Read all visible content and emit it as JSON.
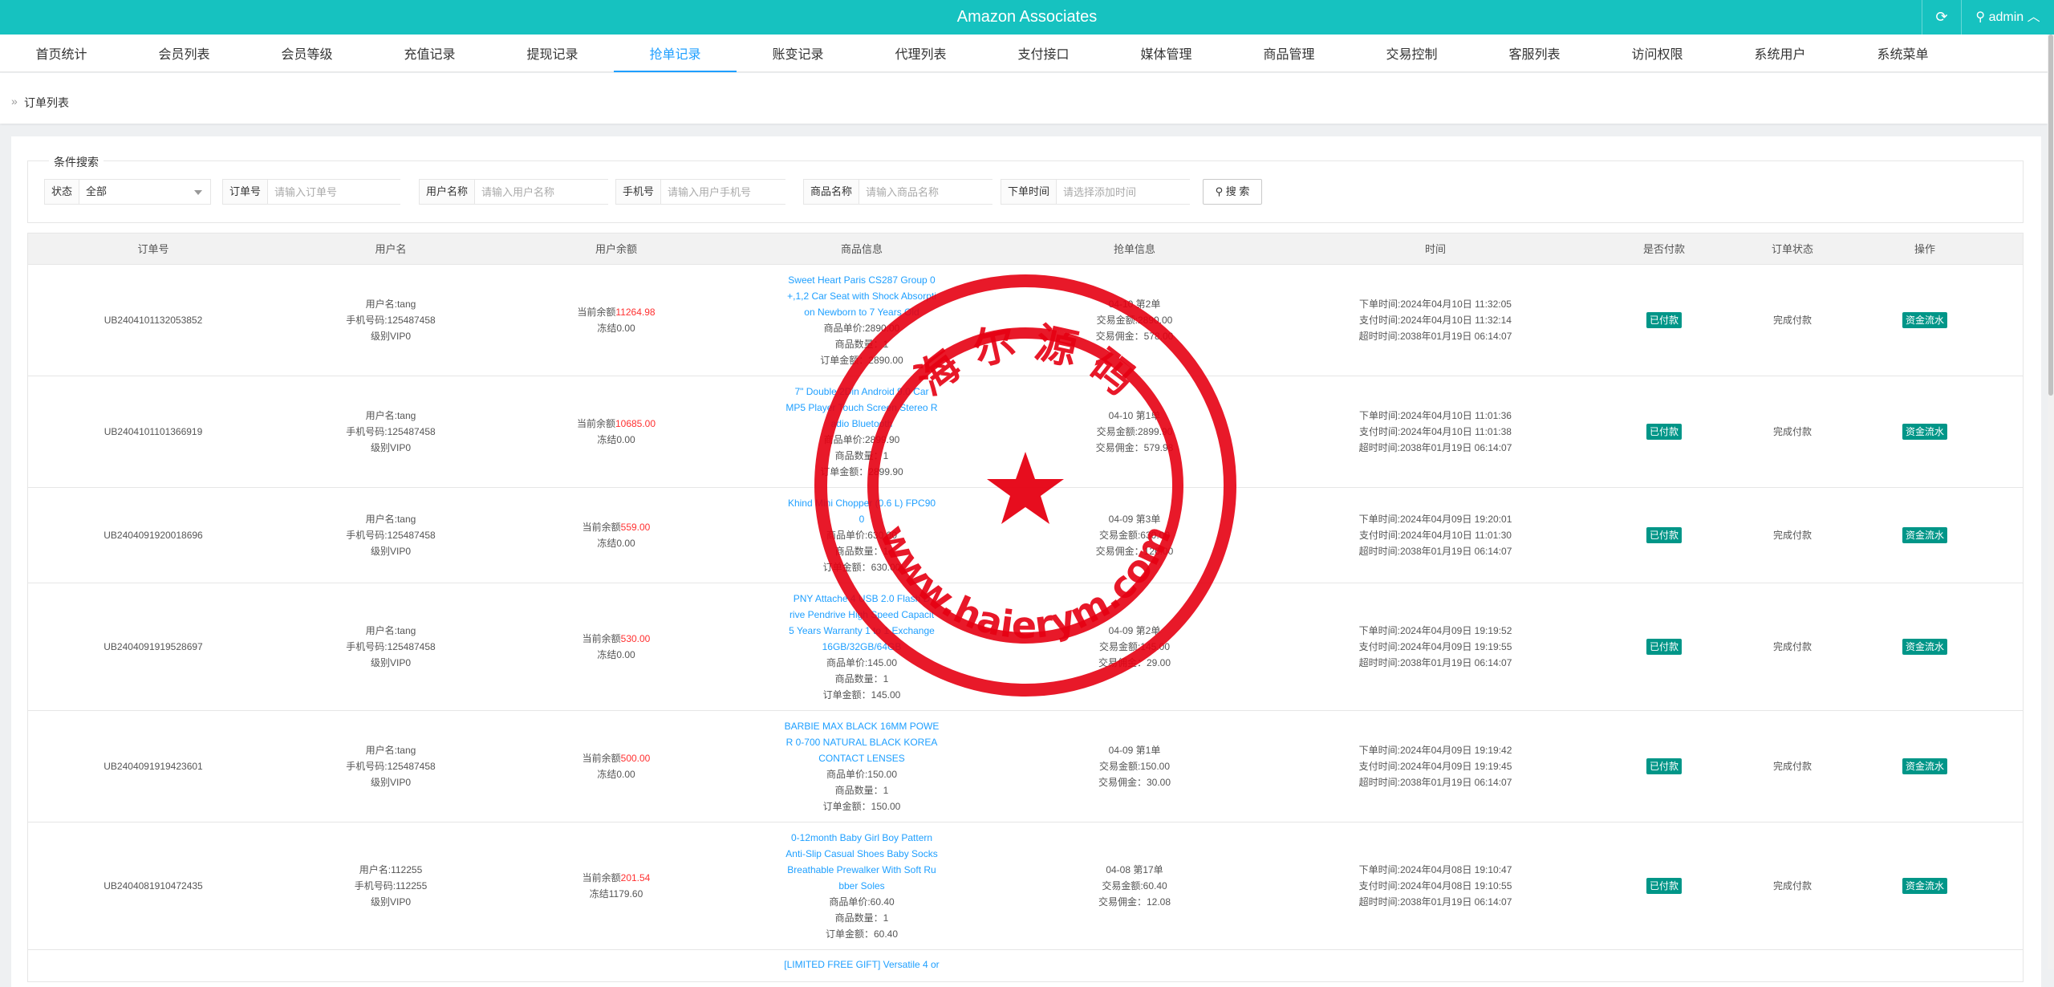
{
  "app": {
    "title": "Amazon Associates",
    "user": "admin"
  },
  "nav": [
    {
      "label": "首页统计"
    },
    {
      "label": "会员列表"
    },
    {
      "label": "会员等级"
    },
    {
      "label": "充值记录"
    },
    {
      "label": "提现记录"
    },
    {
      "label": "抢单记录"
    },
    {
      "label": "账变记录"
    },
    {
      "label": "代理列表"
    },
    {
      "label": "支付接口"
    },
    {
      "label": "媒体管理"
    },
    {
      "label": "商品管理"
    },
    {
      "label": "交易控制"
    },
    {
      "label": "客服列表"
    },
    {
      "label": "访问权限"
    },
    {
      "label": "系统用户"
    },
    {
      "label": "系统菜单"
    }
  ],
  "breadcrumb": "订单列表",
  "search": {
    "legend": "条件搜索",
    "status_label": "状态",
    "status_value": "全部",
    "order_label": "订单号",
    "order_placeholder": "请输入订单号",
    "user_label": "用户名称",
    "user_placeholder": "请输入用户名称",
    "phone_label": "手机号",
    "phone_placeholder": "请输入用户手机号",
    "product_label": "商品名称",
    "product_placeholder": "请输入商品名称",
    "time_label": "下单时间",
    "time_placeholder": "请选择添加时间",
    "button": "搜 索"
  },
  "columns": [
    "订单号",
    "用户名",
    "用户余额",
    "商品信息",
    "抢单信息",
    "时间",
    "是否付款",
    "订单状态",
    "操作"
  ],
  "rows": [
    {
      "order_id": "UB2404101132053852",
      "user": [
        "用户名:tang",
        "手机号码:125487458",
        "级别VIP0"
      ],
      "balance_label": "当前余额",
      "balance": "11264.98",
      "frozen": "冻结0.00",
      "product_lines": [
        "Sweet Heart Paris CS287 Group 0",
        "+,1,2 Car Seat with Shock Absorpti",
        "on Newborn to 7 Years Old"
      ],
      "product_info": [
        "商品单价:2890.00",
        "商品数量：1",
        "订单金额：2890.00"
      ],
      "grab": [
        "04-10 第2单",
        "交易金额:2890.00",
        "交易佣金：578.00"
      ],
      "time": [
        "下单时间:2024年04月10日 11:32:05",
        "支付时间:2024年04月10日 11:32:14",
        "超时时间:2038年01月19日 06:14:07"
      ],
      "paid": "已付款",
      "status": "完成付款",
      "action": "资金流水"
    },
    {
      "order_id": "UB2404101101366919",
      "user": [
        "用户名:tang",
        "手机号码:125487458",
        "级别VIP0"
      ],
      "balance_label": "当前余额",
      "balance": "10685.00",
      "frozen": "冻结0.00",
      "product_lines": [
        "7\" Double 2Din Android 9.0 Car",
        "MP5 Player Touch Screen Stereo R",
        "adio Bluetooth"
      ],
      "product_info": [
        "商品单价:2899.90",
        "商品数量：1",
        "订单金额：2899.90"
      ],
      "grab": [
        "04-10 第1单",
        "交易金额:2899.90",
        "交易佣金：579.98"
      ],
      "time": [
        "下单时间:2024年04月10日 11:01:36",
        "支付时间:2024年04月10日 11:01:38",
        "超时时间:2038年01月19日 06:14:07"
      ],
      "paid": "已付款",
      "status": "完成付款",
      "action": "资金流水"
    },
    {
      "order_id": "UB2404091920018696",
      "user": [
        "用户名:tang",
        "手机号码:125487458",
        "级别VIP0"
      ],
      "balance_label": "当前余额",
      "balance": "559.00",
      "frozen": "冻结0.00",
      "product_lines": [
        "Khind Mini Chopper (0.6 L) FPC90",
        "0"
      ],
      "product_info": [
        "商品单价:630.00",
        "商品数量：1",
        "订单金额：630.00"
      ],
      "grab": [
        "04-09 第3单",
        "交易金额:630.00",
        "交易佣金：126.00"
      ],
      "time": [
        "下单时间:2024年04月09日 19:20:01",
        "支付时间:2024年04月10日 11:01:30",
        "超时时间:2038年01月19日 06:14:07"
      ],
      "paid": "已付款",
      "status": "完成付款",
      "action": "资金流水"
    },
    {
      "order_id": "UB2404091919528697",
      "user": [
        "用户名:tang",
        "手机号码:125487458",
        "级别VIP0"
      ],
      "balance_label": "当前余额",
      "balance": "530.00",
      "frozen": "冻结0.00",
      "product_lines": [
        "PNY Attache 4 USB 2.0 Flash D",
        "rive Pendrive High Speed Capacit",
        "5 Years Warranty 1 to 1 Exchange",
        "16GB/32GB/64GB"
      ],
      "product_info": [
        "商品单价:145.00",
        "商品数量：1",
        "订单金额：145.00"
      ],
      "grab": [
        "04-09 第2单",
        "交易金额:145.00",
        "交易佣金：29.00"
      ],
      "time": [
        "下单时间:2024年04月09日 19:19:52",
        "支付时间:2024年04月09日 19:19:55",
        "超时时间:2038年01月19日 06:14:07"
      ],
      "paid": "已付款",
      "status": "完成付款",
      "action": "资金流水"
    },
    {
      "order_id": "UB2404091919423601",
      "user": [
        "用户名:tang",
        "手机号码:125487458",
        "级别VIP0"
      ],
      "balance_label": "当前余额",
      "balance": "500.00",
      "frozen": "冻结0.00",
      "product_lines": [
        "BARBIE MAX BLACK 16MM POWE",
        "R 0-700 NATURAL BLACK KOREA",
        "CONTACT LENSES"
      ],
      "product_info": [
        "商品单价:150.00",
        "商品数量：1",
        "订单金额：150.00"
      ],
      "grab": [
        "04-09 第1单",
        "交易金额:150.00",
        "交易佣金：30.00"
      ],
      "time": [
        "下单时间:2024年04月09日 19:19:42",
        "支付时间:2024年04月09日 19:19:45",
        "超时时间:2038年01月19日 06:14:07"
      ],
      "paid": "已付款",
      "status": "完成付款",
      "action": "资金流水"
    },
    {
      "order_id": "UB2404081910472435",
      "user": [
        "用户名:112255",
        "手机号码:112255",
        "级别VIP0"
      ],
      "balance_label": "当前余额",
      "balance": "201.54",
      "frozen": "冻结1179.60",
      "product_lines": [
        "0-12month Baby Girl Boy Pattern",
        "Anti-Slip Casual Shoes Baby Socks",
        "Breathable Prewalker With Soft Ru",
        "bber Soles"
      ],
      "product_info": [
        "商品单价:60.40",
        "商品数量：1",
        "订单金额：60.40"
      ],
      "grab": [
        "04-08 第17单",
        "交易金额:60.40",
        "交易佣金：12.08"
      ],
      "time": [
        "下单时间:2024年04月08日 19:10:47",
        "支付时间:2024年04月08日 19:10:55",
        "超时时间:2038年01月19日 06:14:07"
      ],
      "paid": "已付款",
      "status": "完成付款",
      "action": "资金流水"
    }
  ],
  "partial_row_product": "[LIMITED FREE GIFT] Versatile 4 or",
  "watermark": {
    "top_text": "海 尔 源 码",
    "bottom_text": "www.haierym.com",
    "color": "#e60012"
  }
}
